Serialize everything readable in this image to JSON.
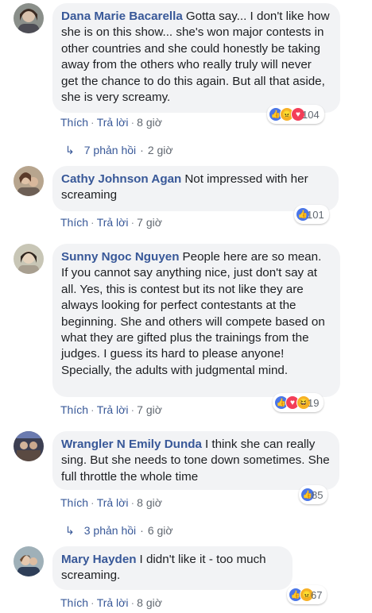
{
  "comments": [
    {
      "author": "Dana Marie Bacarella",
      "text": "Gotta say... I don't like how she is on this show... she's won major contests in other countries and she could honestly be taking away from the others who really truly will never get the chance to do this again. But all that aside, she is very screamy.",
      "like": "Thích",
      "reply": "Trả lời",
      "time": "8 giờ",
      "reactions": [
        "like-icon",
        "angry-icon",
        "love-icon"
      ],
      "reaction_count": "104",
      "replies": {
        "count": "7 phản hồi",
        "time": "2 giờ"
      }
    },
    {
      "author": "Cathy Johnson Agan",
      "text": "Not impressed with her screaming",
      "like": "Thích",
      "reply": "Trả lời",
      "time": "7 giờ",
      "reactions": [
        "like-icon"
      ],
      "reaction_count": "101"
    },
    {
      "author": "Sunny Ngoc Nguyen",
      "text": "People here are so mean. If you cannot say anything nice, just don't say at all. Yes, this is contest but its not like they are always looking for perfect contestants at the beginning. She and others will compete based on what they are gifted plus the trainings from the judges. I guess its hard to please anyone! Specially, the adults with judgmental mind.",
      "like": "Thích",
      "reply": "Trả lời",
      "time": "7 giờ",
      "reactions": [
        "like-icon",
        "love-icon",
        "haha-icon"
      ],
      "reaction_count": "19"
    },
    {
      "author": "Wrangler N Emily Dunda",
      "text": "I think she can really sing. But she needs to tone down sometimes. She full throttle the whole time",
      "like": "Thích",
      "reply": "Trả lời",
      "time": "8 giờ",
      "reactions": [
        "like-icon"
      ],
      "reaction_count": "85",
      "replies": {
        "count": "3 phản hồi",
        "time": "6 giờ"
      }
    },
    {
      "author": "Mary Hayden",
      "text": "I didn't like it - too much screaming.",
      "like": "Thích",
      "reply": "Trả lời",
      "time": "8 giờ",
      "reactions": [
        "like-icon",
        "angry-icon"
      ],
      "reaction_count": "67"
    }
  ],
  "colors": {
    "author": "#385898",
    "bubble": "#f2f3f5",
    "meta": "#606770",
    "like": "#4a76e8",
    "love": "#f33e58",
    "yellow": "#f7b125"
  }
}
